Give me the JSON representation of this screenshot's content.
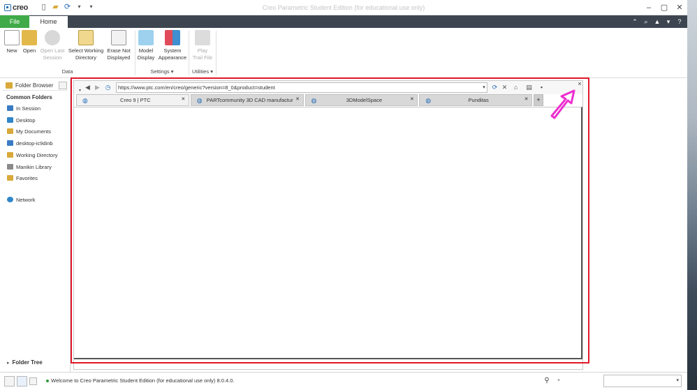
{
  "titlebar": {
    "logo_text": "creo",
    "title": "Creo Parametric Student Edition (for educational use only)",
    "qat_icons": [
      "new-file-icon",
      "open-folder-icon",
      "regenerate-icon",
      "qat-dropdown-icon"
    ],
    "window_controls": [
      "minimize-icon",
      "restore-icon",
      "close-icon"
    ]
  },
  "tabs": {
    "file": "File",
    "home": "Home",
    "right_icons": [
      "collapse-icon",
      "search-icon",
      "graduation-cap-icon",
      "menu-icon",
      "help-icon"
    ]
  },
  "ribbon": {
    "new": "New",
    "open": "Open",
    "open_last_1": "Open Last",
    "open_last_2": "Session",
    "select_wd_1": "Select Working",
    "select_wd_2": "Directory",
    "erase_1": "Erase Not",
    "erase_2": "Displayed",
    "model_display_1": "Model",
    "model_display_2": "Display",
    "system_app_1": "System",
    "system_app_2": "Appearance",
    "play_1": "Play",
    "play_2": "Trail File",
    "group_data": "Data",
    "group_settings": "Settings ▾",
    "group_utilities": "Utilities ▾"
  },
  "left_panel": {
    "header": "Folder Browser",
    "common_folders": "Common Folders",
    "items": [
      {
        "label": "In Session",
        "color": "#3b7bc4"
      },
      {
        "label": "Desktop",
        "color": "#2f86c9"
      },
      {
        "label": "My Documents",
        "color": "#d9a93a"
      },
      {
        "label": "desktop-ic9dinb",
        "color": "#3b7bc4"
      },
      {
        "label": "Working Directory",
        "color": "#d9a93a"
      },
      {
        "label": "Manikin Library",
        "color": "#8a8a8a"
      },
      {
        "label": "Favorites",
        "color": "#d9a93a"
      },
      {
        "label": "Network",
        "color": "#2f86c9"
      }
    ],
    "folder_tree": "Folder Tree"
  },
  "browser": {
    "url": "https://www.ptc.com/en/creo/generic?version=8_0&product=student",
    "tabs": [
      {
        "label": "Creo 9 | PTC"
      },
      {
        "label": "PARTcommunity 3D CAD manufacturer"
      },
      {
        "label": "3DModelSpace"
      },
      {
        "label": "Punditas"
      }
    ],
    "new_tab": "+",
    "close": "×"
  },
  "status": {
    "message": "Welcome to Creo Parametric Student Edition (for educational use only) 8.0.4.0."
  },
  "colors": {
    "file_tab": "#3faa47",
    "tab_bar": "#3d4650",
    "highlight": "#e0162b",
    "arrow": "#ee2fcf"
  }
}
